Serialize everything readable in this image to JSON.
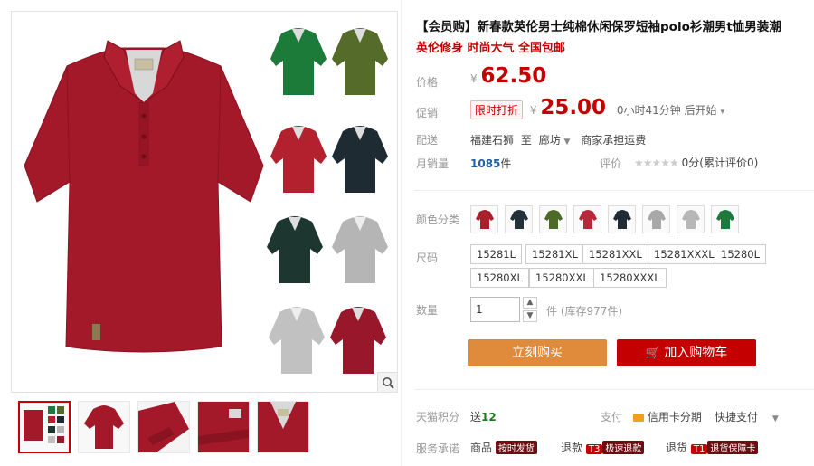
{
  "product": {
    "title": "【会员购】新春款英伦男士纯棉休闲保罗短袖polo衫潮男t恤男装潮",
    "subtitle": "英伦修身 时尚大气 全国包邮"
  },
  "price": {
    "label": "价格",
    "currency": "¥",
    "value": "62.50"
  },
  "promo": {
    "label": "促销",
    "tag": "限时打折",
    "currency": "¥",
    "value": "25.00",
    "countdown": "0小时41分钟 后开始"
  },
  "delivery": {
    "label": "配送",
    "from": "福建石狮",
    "to_word": "至",
    "to": "廊坊",
    "fee": "商家承担运费"
  },
  "sales": {
    "label": "月销量",
    "count": "1085",
    "unit": "件",
    "rating_label": "评价",
    "stars": "★★★★★",
    "rating_text": "0分(累计评价0)"
  },
  "colors": {
    "label": "颜色分类",
    "items": [
      {
        "name": "burgundy",
        "color": "#a8202c"
      },
      {
        "name": "navy",
        "color": "#23313a"
      },
      {
        "name": "olive",
        "color": "#4d6b27"
      },
      {
        "name": "red",
        "color": "#b8283a"
      },
      {
        "name": "dark-navy",
        "color": "#1f2c36"
      },
      {
        "name": "grey",
        "color": "#a8a8a8"
      },
      {
        "name": "light-grey",
        "color": "#b7b7b7"
      },
      {
        "name": "green",
        "color": "#1e7a3c"
      }
    ]
  },
  "sizes": {
    "label": "尺码",
    "items": [
      "15281L",
      "15281XL",
      "15281XXL",
      "15281XXXL",
      "15280L",
      "15280XL",
      "15280XXL",
      "15280XXXL"
    ]
  },
  "quantity": {
    "label": "数量",
    "value": "1",
    "unit": "件",
    "stock": "(库存977件)"
  },
  "actions": {
    "buy_now": "立刻购买",
    "add_cart": "加入购物车"
  },
  "extras": {
    "points_label": "天猫积分",
    "points_prefix": "送",
    "points": "12",
    "pay_label": "支付",
    "credit": "信用卡分期",
    "quickpay": "快捷支付",
    "service_label": "服务承诺",
    "service_1_prefix": "商品",
    "service_1_badge": "按时发货",
    "service_2_prefix": "退款",
    "service_2_badge_a": "T3",
    "service_2_badge_b": "极速退款",
    "service_3_prefix": "退货",
    "service_3_badge_a": "T1",
    "service_3_badge_b": "退货保障卡"
  },
  "swatch_colors": {
    "main": "#a3192a",
    "collar_inner": "#d8d8d8",
    "green": "#1d7b3a",
    "olive": "#556b2a",
    "red": "#b3202e",
    "navy": "#1f2b33",
    "dark_green": "#1e3630",
    "grey": "#b5b5b5",
    "light_grey": "#c1c1c1",
    "burgundy": "#98172a"
  }
}
